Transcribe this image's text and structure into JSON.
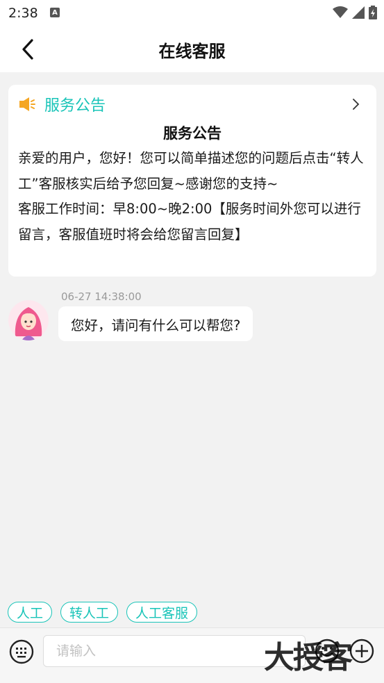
{
  "status_bar": {
    "time": "2:38",
    "notification_icon": "A"
  },
  "nav": {
    "title": "在线客服",
    "back_icon": "chevron-left-icon"
  },
  "notice": {
    "header_label": "服务公告",
    "title": "服务公告",
    "body_line1": "亲爱的用户，您好！您可以简单描述您的问题后点击“转人工”客服核实后给予您回复~感谢您的支持~",
    "body_line2": "客服工作时间：早8:00~晚2:00【服务时间外您可以进行留言，客服值班时将会给您留言回复】"
  },
  "messages": [
    {
      "time": "06-27 14:38:00",
      "text": "您好，请问有什么可以帮您?"
    }
  ],
  "quick_replies": [
    "人工",
    "转人工",
    "人工客服"
  ],
  "input": {
    "placeholder": "请输入",
    "value": ""
  },
  "watermark": "大授客",
  "colors": {
    "accent": "#19c4b8",
    "speaker": "#f5a623"
  }
}
